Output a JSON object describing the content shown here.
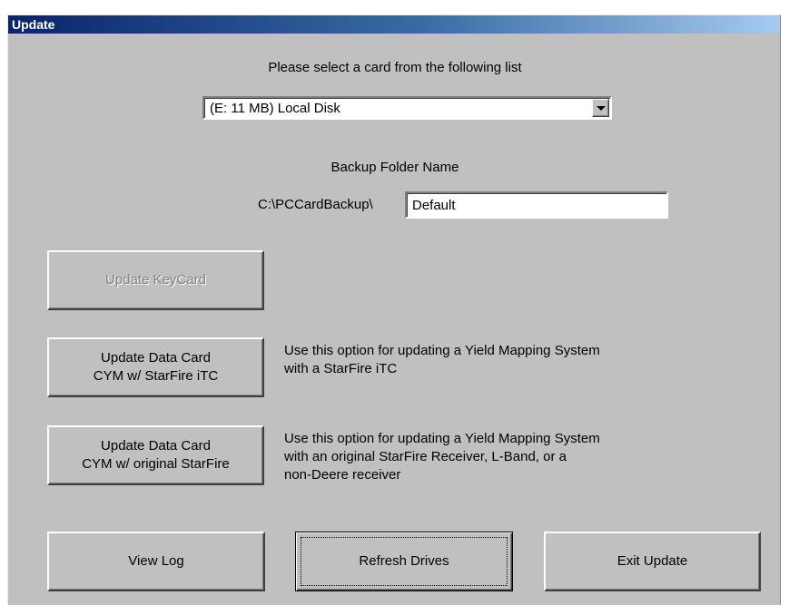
{
  "window": {
    "title": "Update"
  },
  "card_select": {
    "prompt": "Please select a card from the following list",
    "selected": "(E: 11 MB) Local Disk"
  },
  "backup": {
    "label": "Backup Folder Name",
    "path_prefix": "C:\\PCCardBackup\\",
    "folder_value": "Default"
  },
  "buttons": {
    "update_keycard": "Update KeyCard",
    "update_itc_line1": "Update Data Card",
    "update_itc_line2": "CYM w/ StarFire iTC",
    "update_orig_line1": "Update Data Card",
    "update_orig_line2": "CYM w/ original StarFire",
    "view_log": "View Log",
    "refresh_drives": "Refresh Drives",
    "exit_update": "Exit Update"
  },
  "descriptions": {
    "itc_line1": "Use this option for updating a Yield Mapping System",
    "itc_line2": "with a StarFire iTC",
    "orig_line1": "Use this option for updating a Yield Mapping System",
    "orig_line2": "with an original StarFire Receiver, L-Band, or a",
    "orig_line3": "non-Deere receiver"
  },
  "icons": {
    "dropdown": "chevron-down-icon"
  }
}
